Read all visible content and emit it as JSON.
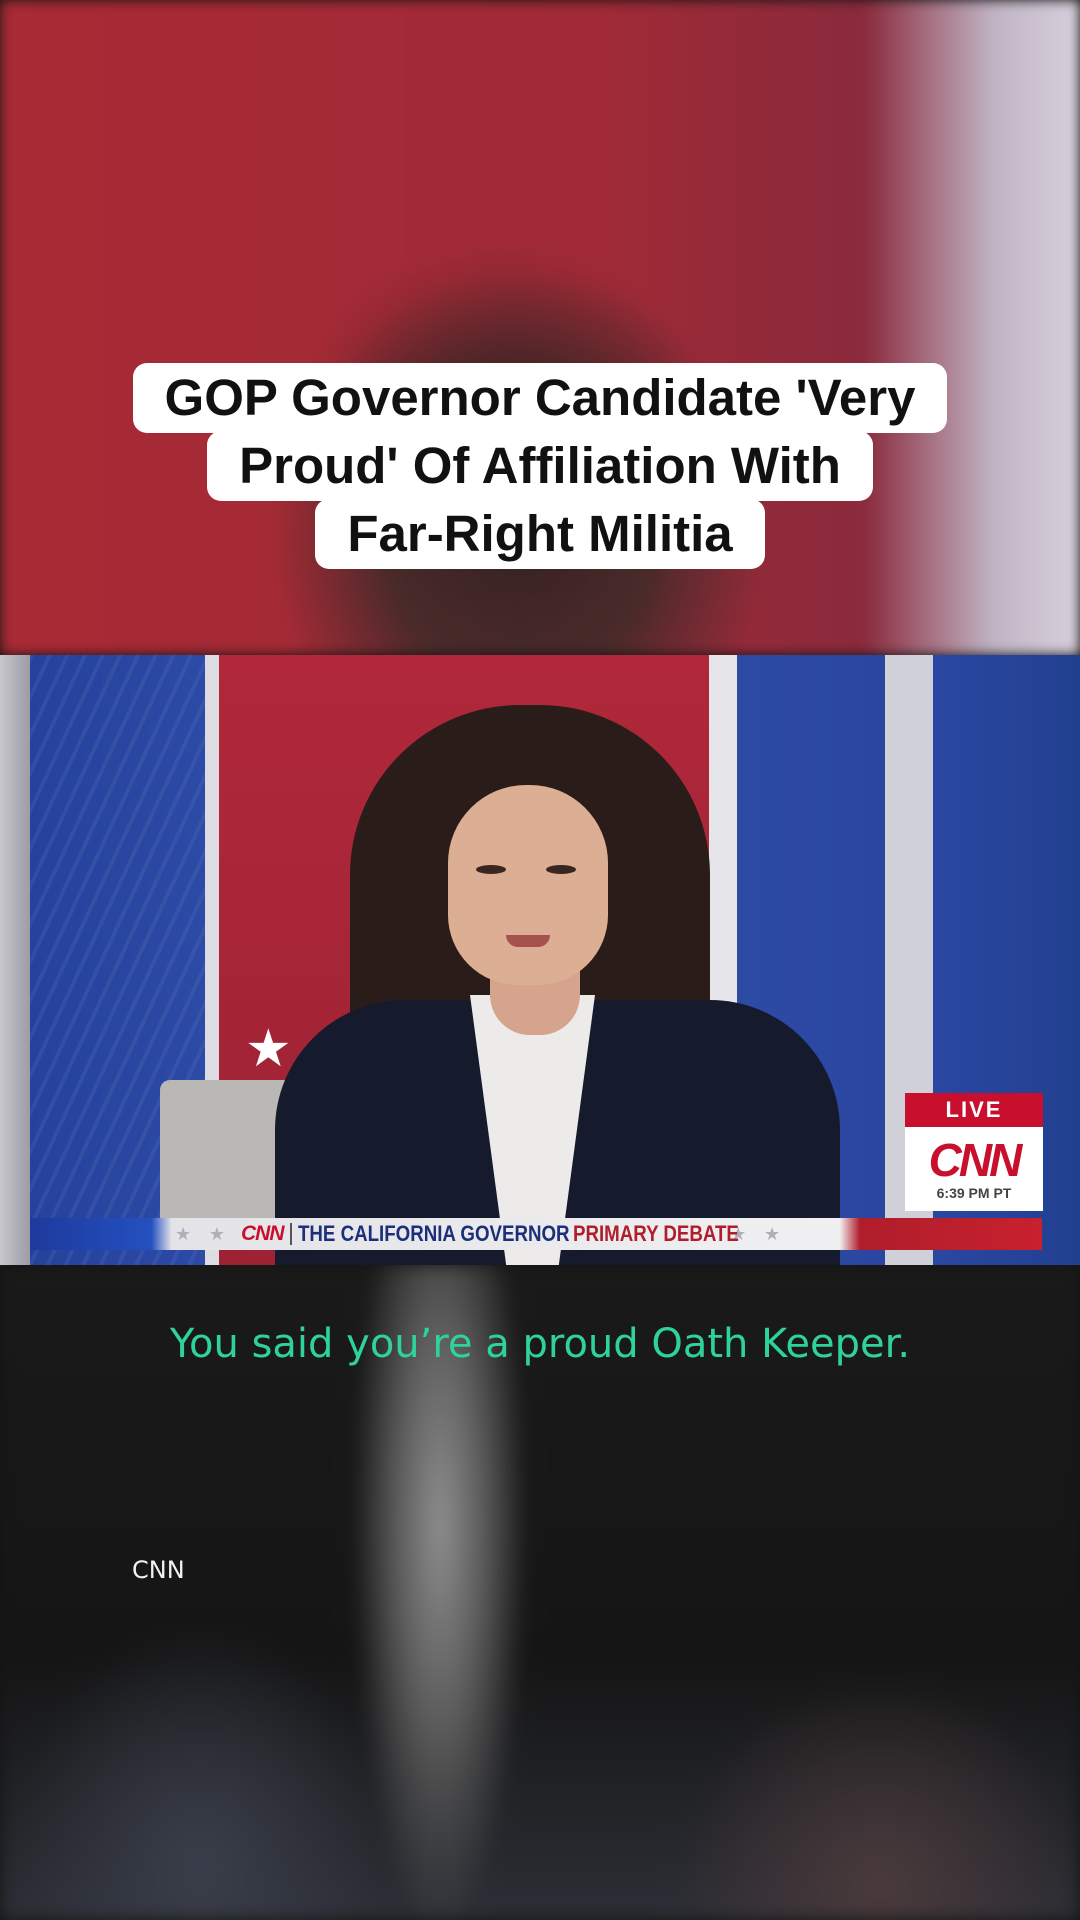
{
  "headline": {
    "lines": [
      "GOP Governor Candidate 'Very",
      "Proud' Of Affiliation With",
      "Far-Right Militia"
    ]
  },
  "video": {
    "ticker": {
      "logo": "CNN",
      "title_part1": "THE CALIFORNIA GOVERNOR",
      "title_part2": "PRIMARY DEBATE"
    },
    "live_bug": {
      "label": "LIVE",
      "logo": "CNN",
      "time": "6:39 PM PT"
    }
  },
  "caption": {
    "text": "You said you’re a proud Oath Keeper."
  },
  "source": {
    "label": "CNN"
  },
  "colors": {
    "caption": "#2ed39a",
    "cnn_red": "#c8102e",
    "studio_blue": "#2c4aa6",
    "studio_red": "#a82a35"
  }
}
